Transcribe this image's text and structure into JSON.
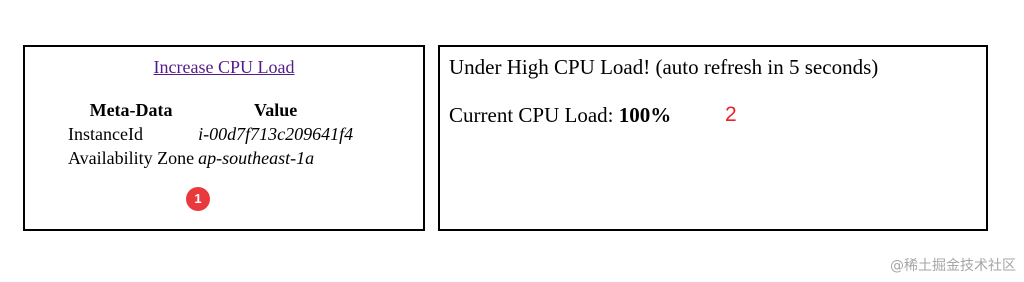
{
  "left_panel": {
    "link_text": "Increase CPU Load",
    "table": {
      "headers": [
        "Meta-Data",
        "Value"
      ],
      "rows": [
        {
          "key": "InstanceId",
          "value": "i-00d7f713c209641f4"
        },
        {
          "key": "Availability Zone",
          "value": "ap-southeast-1a"
        }
      ]
    },
    "badge": "1"
  },
  "right_panel": {
    "status": "Under High CPU Load! (auto refresh in 5 seconds)",
    "cpu_label": "Current CPU Load:",
    "cpu_value": "100%",
    "marker": "2"
  },
  "watermark": "@稀土掘金技术社区",
  "colors": {
    "link": "#551a8b",
    "badge": "#e8393d",
    "marker": "#e8232a",
    "watermark": "#a6a6a6"
  }
}
